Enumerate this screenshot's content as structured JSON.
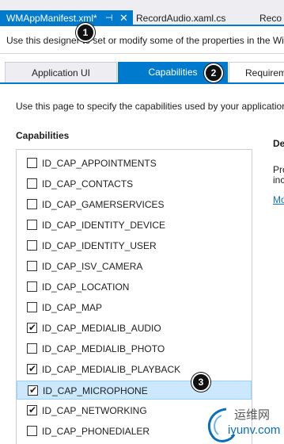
{
  "document_tabs": [
    {
      "label": "WMAppManifest.xml*",
      "pin_icon": "pin-icon",
      "close_icon": "close-icon",
      "active": true
    },
    {
      "label": "RecordAudio.xaml.cs",
      "active": false
    },
    {
      "label": "Reco",
      "active": false
    }
  ],
  "info_bar": {
    "text": "Use this designer to set or modify some of the properties in the Wi"
  },
  "designer_tabs": [
    {
      "label": "Application UI",
      "active": false
    },
    {
      "label": "Capabilities",
      "active": true
    },
    {
      "label": "Requirem",
      "active": false
    }
  ],
  "page_description": "Use this page to specify the capabilities used by your application",
  "capabilities": {
    "heading": "Capabilities",
    "items": [
      {
        "label": "ID_CAP_APPOINTMENTS",
        "checked": false
      },
      {
        "label": "ID_CAP_CONTACTS",
        "checked": false
      },
      {
        "label": "ID_CAP_GAMERSERVICES",
        "checked": false
      },
      {
        "label": "ID_CAP_IDENTITY_DEVICE",
        "checked": false
      },
      {
        "label": "ID_CAP_IDENTITY_USER",
        "checked": false
      },
      {
        "label": "ID_CAP_ISV_CAMERA",
        "checked": false
      },
      {
        "label": "ID_CAP_LOCATION",
        "checked": false
      },
      {
        "label": "ID_CAP_MAP",
        "checked": false
      },
      {
        "label": "ID_CAP_MEDIALIB_AUDIO",
        "checked": true
      },
      {
        "label": "ID_CAP_MEDIALIB_PHOTO",
        "checked": false
      },
      {
        "label": "ID_CAP_MEDIALIB_PLAYBACK",
        "checked": true
      },
      {
        "label": "ID_CAP_MICROPHONE",
        "checked": true,
        "selected": true
      },
      {
        "label": "ID_CAP_NETWORKING",
        "checked": true
      },
      {
        "label": "ID_CAP_PHONEDIALER",
        "checked": false
      }
    ],
    "check_glyph": "✔"
  },
  "description_panel": {
    "heading": "De",
    "line1": "Pro",
    "line2": "inc",
    "link": "Mo"
  },
  "markers": [
    "1",
    "2",
    "3"
  ],
  "watermark": {
    "chinese": "运维网",
    "latin": "iyunv.com"
  },
  "colors": {
    "accent": "#007acc",
    "selection": "#cce8ff",
    "link": "#0e70c0"
  }
}
